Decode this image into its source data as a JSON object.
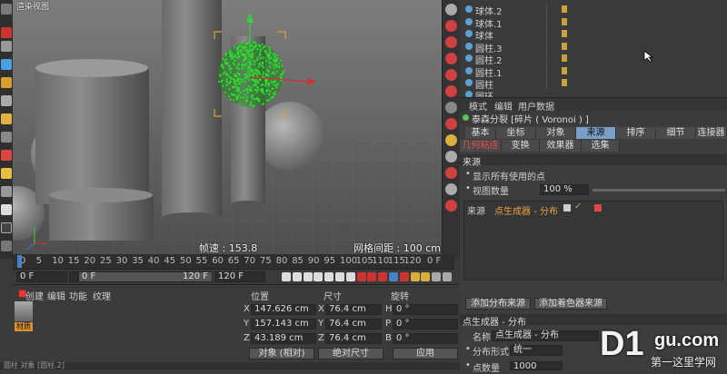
{
  "viewport": {
    "corner_label": "渲染视图",
    "speed_label": "帧速 : 153.8",
    "grid_label": "网格间距 : 100 cm"
  },
  "objects": [
    {
      "name": "球体.2"
    },
    {
      "name": "球体.1"
    },
    {
      "name": "球体"
    },
    {
      "name": "圆柱.3"
    },
    {
      "name": "圆柱.2"
    },
    {
      "name": "圆柱.1"
    },
    {
      "name": "圆柱"
    },
    {
      "name": "圆环"
    }
  ],
  "attr": {
    "menu": [
      "模式",
      "编辑",
      "用户数据"
    ],
    "title": "泰森分裂 [碎片 ( Voronoi ) ]",
    "tabs_row1": [
      "基本",
      "坐标",
      "对象",
      "来源",
      "排序",
      "细节",
      "连接器"
    ],
    "tabs_row2": [
      "几何粘连",
      "变换",
      "效果器",
      "选集"
    ],
    "section_source": "来源",
    "show_all_points": "显示所有使用的点",
    "view_count_label": "视图数量",
    "view_count_value": "100 %",
    "source_label": "来源",
    "source_value": "点生成器 - 分布",
    "add_dist_btn": "添加分布来源",
    "add_shader_btn": "添加着色器来源",
    "section_gen": "点生成器 - 分布",
    "name_label": "名称",
    "name_value": "点生成器 - 分布",
    "dist_form_label": "分布形式",
    "dist_form_value": "统一",
    "point_count_label": "点数量",
    "point_count_value": "1000"
  },
  "timeline": {
    "ticks": [
      "0",
      "5",
      "10",
      "15",
      "20",
      "25",
      "30",
      "35",
      "40",
      "45",
      "50",
      "55",
      "60",
      "65",
      "70",
      "75",
      "80",
      "85",
      "90",
      "95",
      "100",
      "105",
      "110",
      "115",
      "120"
    ],
    "end_label": "0 F",
    "start_field": "0 F",
    "range_start": "0 F",
    "range_end": "120 F",
    "max_field": "120 F"
  },
  "materials": {
    "menu": [
      "创建",
      "编辑",
      "功能",
      "纹理"
    ],
    "mat_name": "材质"
  },
  "coords": {
    "headers": [
      "位置",
      "尺寸",
      "旋转"
    ],
    "rows": [
      {
        "axis": "X",
        "pos": "147.626 cm",
        "size_axis": "X",
        "size": "76.4 cm",
        "rot_axis": "H",
        "rot": "0 °"
      },
      {
        "axis": "Y",
        "pos": "157.143 cm",
        "size_axis": "Y",
        "size": "76.4 cm",
        "rot_axis": "P",
        "rot": "0 °"
      },
      {
        "axis": "Z",
        "pos": "43.189 cm",
        "size_axis": "Z",
        "size": "76.4 cm",
        "rot_axis": "B",
        "rot": "0 °"
      }
    ],
    "mode_object": "对象 (相对)",
    "mode_size": "绝对尺寸",
    "apply": "应用"
  },
  "status": "圆柱 对象 [圆柱.2]",
  "watermark": {
    "big": "D1",
    "site": "gu.com",
    "sub": "第一这里学网"
  },
  "colors": {
    "accent": "#7a9ec8",
    "points": "#2ee02e",
    "source": "#e8a040"
  }
}
